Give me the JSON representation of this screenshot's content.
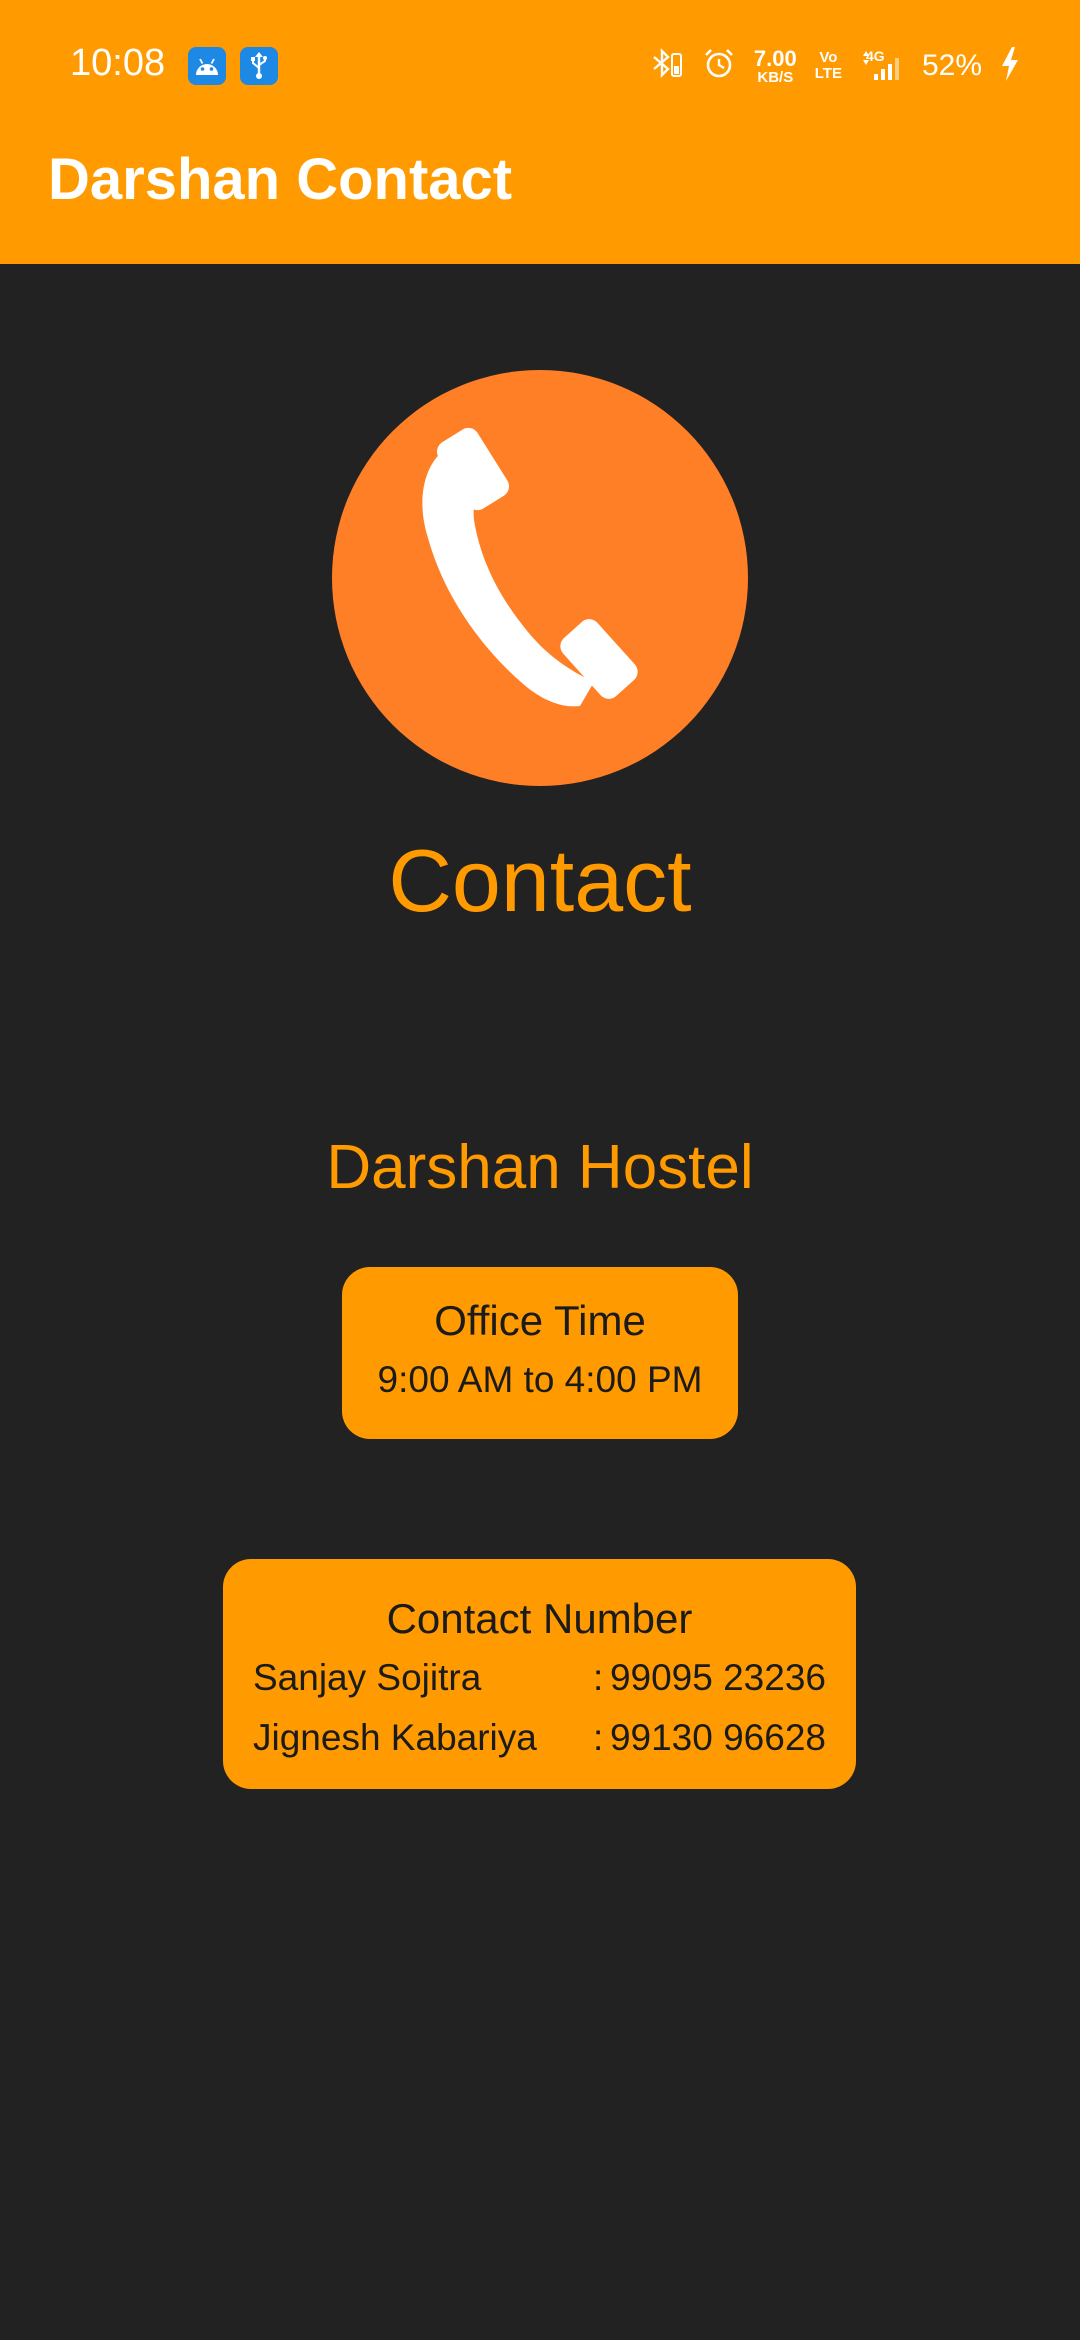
{
  "status_bar": {
    "time": "10:08",
    "notification_icons": [
      "android-icon",
      "usb-icon"
    ],
    "net_speed_value": "7.00",
    "net_speed_unit": "KB/S",
    "volte_top": "Vo",
    "volte_bottom": "LTE",
    "network_type": "4G",
    "battery": "52%"
  },
  "app_bar": {
    "title": "Darshan Contact"
  },
  "main": {
    "icon": "phone-icon",
    "heading": "Contact",
    "hostel_name": "Darshan Hostel",
    "office": {
      "label": "Office Time",
      "hours": "9:00 AM to 4:00 PM"
    },
    "contact_card": {
      "title": "Contact Number",
      "rows": [
        {
          "name": "Sanjay Sojitra",
          "separator": ":",
          "number": "99095 23236"
        },
        {
          "name": "Jignesh Kabariya",
          "separator": ":",
          "number": "99130 96628"
        }
      ]
    }
  },
  "colors": {
    "accent": "#FF9A00",
    "icon_circle": "#FF7F26",
    "background": "#222222",
    "card_text": "#1B1B1B"
  }
}
